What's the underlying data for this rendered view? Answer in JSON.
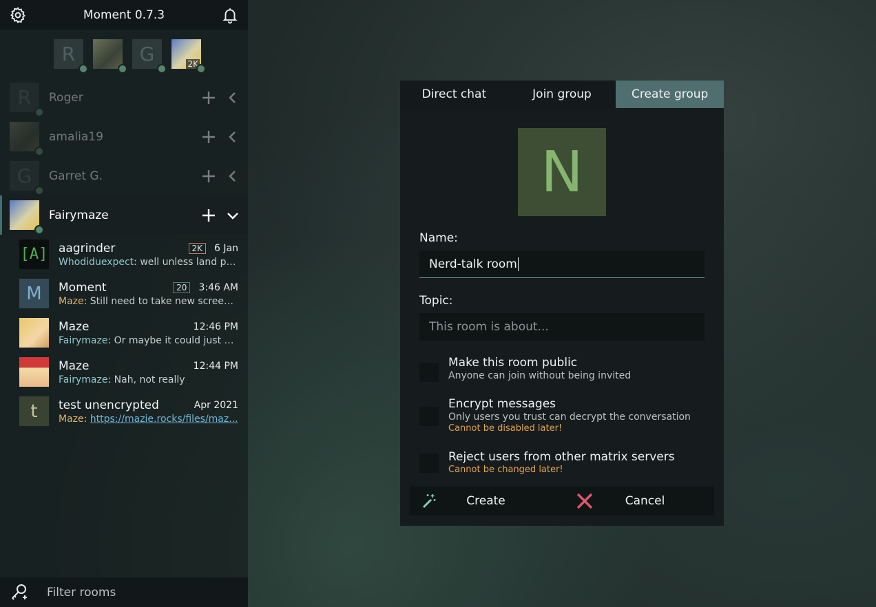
{
  "app": {
    "title": "Moment 0.7.3"
  },
  "icons": {
    "settings": "settings-gear-icon",
    "notifications": "bell-icon",
    "filter": "filter-key-icon",
    "create": "magic-wand-icon",
    "cancel": "x-cross-icon"
  },
  "accounts_strip": [
    {
      "letter": "R",
      "kind": "letter"
    },
    {
      "letter": "",
      "kind": "cat"
    },
    {
      "letter": "G",
      "kind": "letter"
    },
    {
      "letter": "",
      "kind": "pony",
      "badge": "2K"
    }
  ],
  "accounts": [
    {
      "name": "Roger",
      "letter": "R"
    },
    {
      "name": "amalia19",
      "letter": ""
    },
    {
      "name": "Garret G.",
      "letter": "G"
    },
    {
      "name": "Fairymaze",
      "letter": ""
    }
  ],
  "rooms": [
    {
      "avatar": "[A]",
      "name": "aagrinder",
      "unread": "2K",
      "time": "6 Jan",
      "sender": "Whodiduexpect",
      "message": "well unless land pr..."
    },
    {
      "avatar": "M",
      "name": "Moment",
      "unread": "20",
      "time": "3:46 AM",
      "sender": "Maze",
      "message": "Still need to take new screens..."
    },
    {
      "avatar": "",
      "name": "Maze",
      "unread": "",
      "time": "12:46 PM",
      "sender": "Fairymaze",
      "message": "Or maybe it could just be..."
    },
    {
      "avatar": "",
      "name": "Maze",
      "unread": "",
      "time": "12:44 PM",
      "sender": "Fairymaze",
      "message": "Nah, not really"
    },
    {
      "avatar": "t",
      "name": "test unencrypted",
      "unread": "",
      "time": "Apr 2021",
      "sender": "Maze",
      "message": "https://mazie.rocks/files/maz..."
    }
  ],
  "filter": {
    "placeholder": "Filter rooms"
  },
  "dialog": {
    "tabs": [
      "Direct chat",
      "Join group",
      "Create group"
    ],
    "active_tab": "Create group",
    "avatar_letter": "N",
    "name_label": "Name:",
    "name_value": "Nerd-talk room",
    "topic_label": "Topic:",
    "topic_placeholder": "This room is about...",
    "options": [
      {
        "title": "Make this room public",
        "subtitle": "Anyone can join without being invited",
        "warning": "",
        "checked": false
      },
      {
        "title": "Encrypt messages",
        "subtitle": "Only users you trust can decrypt the conversation",
        "warning": "Cannot be disabled later!",
        "checked": false
      },
      {
        "title": "Reject users from other matrix servers",
        "subtitle": "",
        "warning": "Cannot be changed later!",
        "checked": false
      }
    ],
    "create_label": "Create",
    "cancel_label": "Cancel"
  },
  "colors": {
    "accent": "#4f6e6f",
    "presence": "#55866a",
    "warning": "#e2a34a",
    "cancel_icon": "#e0566d",
    "create_icon": "#7fcfb5"
  }
}
